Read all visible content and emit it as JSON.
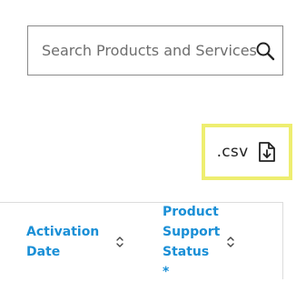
{
  "search": {
    "placeholder": "Search Products and Services",
    "icon": "search-icon"
  },
  "export": {
    "csv_label": ".csv",
    "icon": "file-download-icon",
    "highlight_color": "#eeee70"
  },
  "table": {
    "columns": [
      {
        "label": "Activation Date",
        "sortable": true
      },
      {
        "label": "Product Support Status *",
        "sortable": true
      }
    ],
    "header_color": "#1a8fd6"
  }
}
